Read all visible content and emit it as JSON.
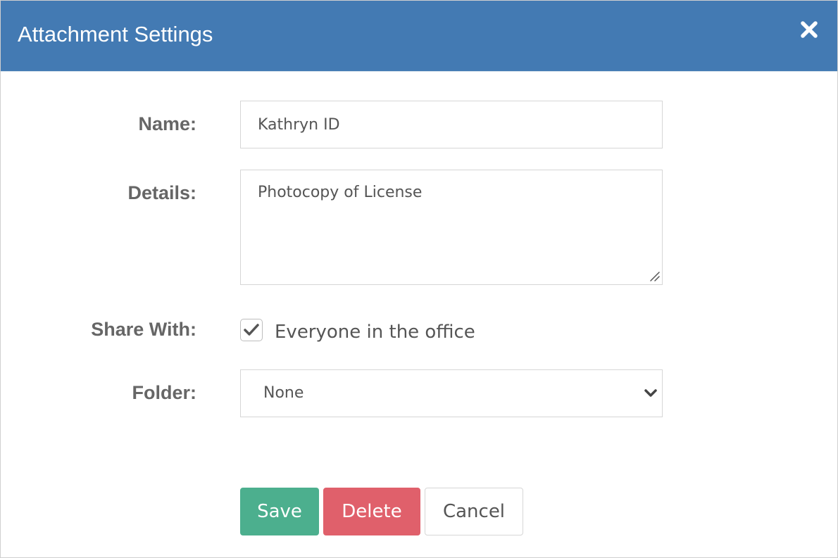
{
  "dialog": {
    "title": "Attachment Settings",
    "close_icon": "close-icon",
    "header_color": "#437ab3"
  },
  "form": {
    "name": {
      "label": "Name:",
      "value": "Kathryn ID"
    },
    "details": {
      "label": "Details:",
      "value": "Photocopy of License"
    },
    "share_with": {
      "label": "Share With:",
      "checked": true,
      "option_label": "Everyone in the office"
    },
    "folder": {
      "label": "Folder:",
      "selected": "None"
    }
  },
  "actions": {
    "save_label": "Save",
    "delete_label": "Delete",
    "cancel_label": "Cancel",
    "save_color": "#4caf8e",
    "delete_color": "#e0606b"
  }
}
